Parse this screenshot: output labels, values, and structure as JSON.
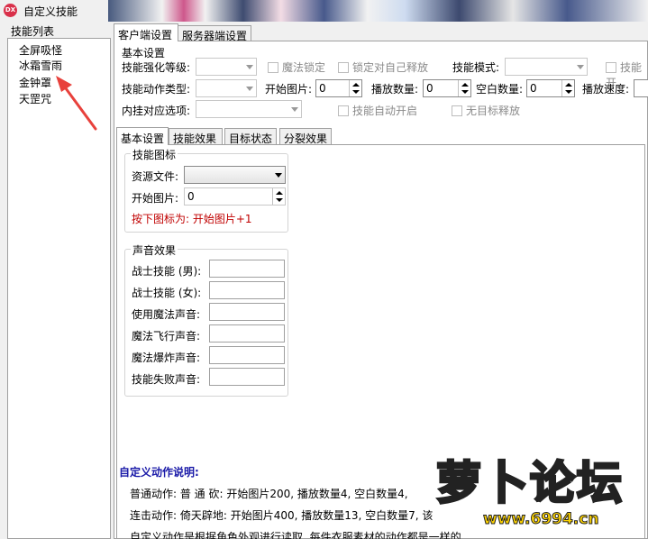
{
  "window": {
    "title": "自定义技能",
    "icon_text": "DX"
  },
  "skill_list": {
    "label": "技能列表",
    "items": [
      "全屏吸怪",
      "冰霜雪雨",
      "金钟罩",
      "天罡咒"
    ]
  },
  "tabs": {
    "client": "客户端设置",
    "server": "服务器端设置"
  },
  "basic": {
    "title": "基本设置",
    "strengthen_label": "技能强化等级:",
    "magic_lock": "魔法锁定",
    "lock_self": "锁定对自己释放",
    "skill_mode_label": "技能模式:",
    "skill_open": "技能开",
    "action_type_label": "技能动作类型:",
    "start_image_label": "开始图片:",
    "start_image_value": "0",
    "play_count_label": "播放数量:",
    "play_count_value": "0",
    "blank_count_label": "空白数量:",
    "blank_count_value": "0",
    "play_speed_label": "播放速度:",
    "hook_label": "内挂对应选项:",
    "auto_open": "技能自动开启",
    "no_target": "无目标释放"
  },
  "inner_tabs": [
    "基本设置",
    "技能效果",
    "目标状态",
    "分裂效果"
  ],
  "icon_group": {
    "title": "技能图标",
    "resource_label": "资源文件:",
    "start_label": "开始图片:",
    "start_value": "0",
    "note": "按下图标为: 开始图片+1"
  },
  "sound_group": {
    "title": "声音效果",
    "fields": [
      "战士技能 (男):",
      "战士技能 (女):",
      "使用魔法声音:",
      "魔法飞行声音:",
      "魔法爆炸声音:",
      "技能失败声音:"
    ]
  },
  "custom_action": {
    "heading": "自定义动作说明:",
    "line1": "普通动作: 普 通 砍: 开始图片200, 播放数量4, 空白数量4,",
    "line2": "连击动作: 倚天辟地: 开始图片400, 播放数量13, 空白数量7, 该",
    "line3": "自定义动作是根据角色外观进行读取, 每件衣服素材的动作都是一样的"
  },
  "watermark": {
    "logo_text": "萝卜论坛",
    "url": "www.6994.cn"
  }
}
